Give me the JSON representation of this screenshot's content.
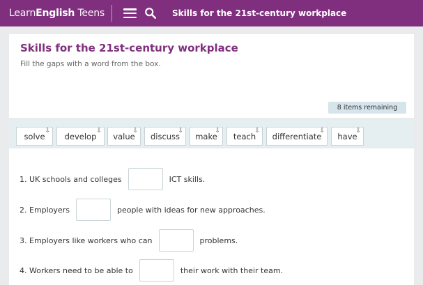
{
  "topbar": {
    "logo_light": "Learn",
    "logo_bold": "English",
    "logo_suffix": " Teens",
    "title": "Skills for the 21st-century workplace",
    "color": "#7f2f7e"
  },
  "exercise": {
    "title": "Skills for the 21st-century workplace",
    "instructions": "Fill the gaps with a word from the box.",
    "remaining": "8 items remaining"
  },
  "word_bank": [
    "solve",
    "develop",
    "value",
    "discuss",
    "make",
    "teach",
    "differentiate",
    "have"
  ],
  "questions": [
    {
      "before": "1. UK schools and colleges",
      "after": "ICT skills."
    },
    {
      "before": "2. Employers",
      "after": "people with ideas for new approaches."
    },
    {
      "before": "3. Employers like workers who can",
      "after": "problems."
    },
    {
      "before": "4. Workers need to be able to",
      "after": "their work with their team."
    }
  ],
  "icons": [
    "hamburger-menu-icon",
    "search-icon",
    "drag-icon"
  ]
}
